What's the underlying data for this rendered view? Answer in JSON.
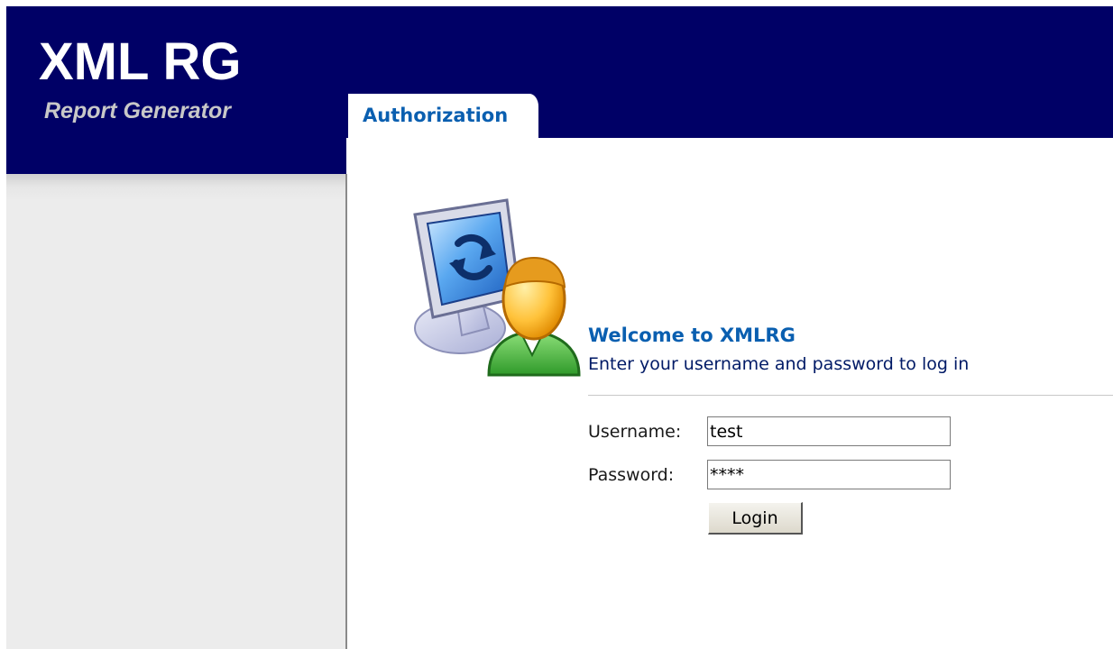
{
  "header": {
    "logo_title": "XML RG",
    "logo_subtitle": "Report Generator",
    "active_tab": "Authorization"
  },
  "login": {
    "illustration_icon": "user-computer-icon",
    "welcome_title": "Welcome to XMLRG",
    "welcome_subtitle": "Enter your username and password to log in",
    "username_label": "Username:",
    "username_value": "test",
    "password_label": "Password:",
    "password_value": "****",
    "login_button": "Login"
  },
  "colors": {
    "header_bg": "#000066",
    "accent": "#0a5fb0",
    "sidebar_bg": "#ececec"
  }
}
